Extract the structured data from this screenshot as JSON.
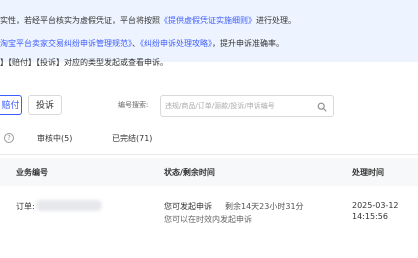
{
  "notice": {
    "line1_prefix": "实性，若经平台核实为虚假凭证，平台将按照",
    "line1_link": "《提供虚假凭证实施细则》",
    "line1_suffix": "进行处理。",
    "line2_link1": "淘宝平台卖家交易纠纷申诉管理规范》",
    "line2_sep": "、",
    "line2_link2": "《纠纷申诉处理攻略》",
    "line2_suffix": "，提升申诉准确率。",
    "line3": "】【赔付】【投诉】对应的类型发起或查看申诉。"
  },
  "tabs": {
    "active": "赔付",
    "other": "投诉"
  },
  "search": {
    "label": "编号搜索:",
    "placeholder": "违规/商品/订单/源款/投诉/申诉编号"
  },
  "status_tabs": {
    "reviewing": "审核中(5)",
    "completed": "已完结(71)"
  },
  "table": {
    "headers": {
      "business_no": "业务编号",
      "status": "状态/剩余时间",
      "handle_time": "处理时间"
    },
    "row": {
      "order_label": "订单:",
      "status": "您可发起申诉",
      "remaining": "剩余14天23小时31分",
      "hint": "您可以在时效内发起申诉",
      "date": "2025-03-12",
      "time": "14:15:56"
    }
  }
}
